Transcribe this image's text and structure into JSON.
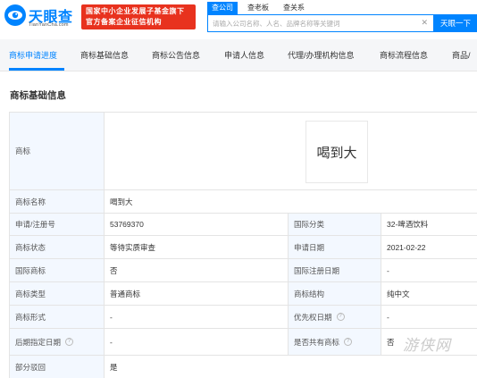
{
  "header": {
    "logo_text": "天眼查",
    "logo_sub": "TianYanCha.com",
    "badge_line1": "国家中小企业发展子基金旗下",
    "badge_line2": "官方备案企业征信机构",
    "search_tabs": [
      {
        "label": "查公司",
        "active": true
      },
      {
        "label": "查老板",
        "active": false
      },
      {
        "label": "查关系",
        "active": false
      }
    ],
    "search_placeholder": "请输入公司名称、人名、品牌名称等关键词",
    "search_button": "天眼一下"
  },
  "nav": {
    "items": [
      {
        "label": "商标申请进度",
        "active": true
      },
      {
        "label": "商标基础信息",
        "active": false
      },
      {
        "label": "商标公告信息",
        "active": false
      },
      {
        "label": "申请人信息",
        "active": false
      },
      {
        "label": "代理/办理机构信息",
        "active": false
      },
      {
        "label": "商标流程信息",
        "active": false
      },
      {
        "label": "商品/",
        "active": false
      }
    ]
  },
  "section": {
    "title": "商标基础信息"
  },
  "trademark": {
    "label": "商标",
    "image_text": "喝到大"
  },
  "rows": [
    {
      "label": "商标名称",
      "value": "喝到大"
    },
    {
      "label": "申请/注册号",
      "value": "53769370",
      "label2": "国际分类",
      "value2": "32-啤酒饮料"
    },
    {
      "label": "商标状态",
      "value": "等待实质审查",
      "label2": "申请日期",
      "value2": "2021-02-22"
    },
    {
      "label": "国际商标",
      "value": "否",
      "label2": "国际注册日期",
      "value2": "-"
    },
    {
      "label": "商标类型",
      "value": "普通商标",
      "label2": "商标结构",
      "value2": "纯中文"
    },
    {
      "label": "商标形式",
      "value": "-",
      "label2": "优先权日期",
      "value2": "-"
    },
    {
      "label": "后期指定日期",
      "value": "-",
      "label2": "是否共有商标",
      "value2": "否"
    },
    {
      "label": "部分驳回",
      "value": "是"
    }
  ],
  "watermark": "游侠网",
  "colors": {
    "brand": "#0084ff",
    "badge": "#e8321e",
    "label_bg": "#f3f8ff"
  }
}
